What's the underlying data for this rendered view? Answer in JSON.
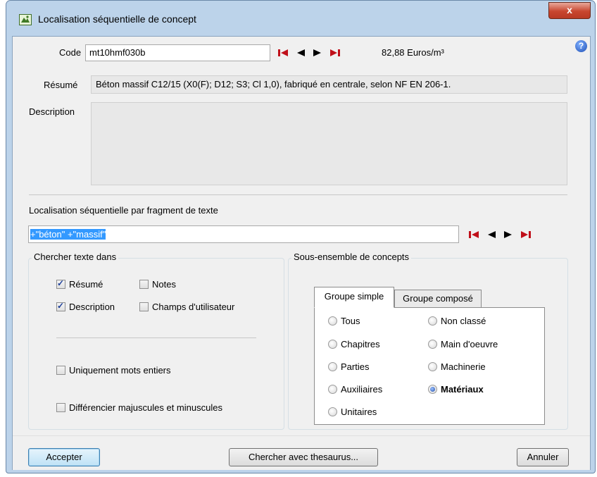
{
  "window": {
    "title": "Localisation séquentielle de concept",
    "close_label": "x"
  },
  "help_label": "?",
  "code": {
    "label": "Code",
    "value": "mt10hmf030b",
    "price": "82,88 Euros/m³"
  },
  "resume": {
    "label": "Résumé",
    "value": "Béton massif C12/15 (X0(F); D12; S3; Cl 1,0), fabriqué en centrale, selon NF EN 206-1."
  },
  "description": {
    "label": "Description",
    "value": ""
  },
  "search": {
    "label": "Localisation séquentielle par fragment de texte",
    "value": "+\"béton\" +\"massif\""
  },
  "search_in": {
    "title": "Chercher texte dans",
    "resume_label": "Résumé",
    "resume_checked": true,
    "notes_label": "Notes",
    "notes_checked": false,
    "description_label": "Description",
    "description_checked": true,
    "user_fields_label": "Champs d'utilisateur",
    "user_fields_checked": false,
    "whole_words_label": "Uniquement mots entiers",
    "case_label": "Différencier majuscules et minuscules"
  },
  "subset": {
    "title": "Sous-ensemble de concepts",
    "tabs": [
      "Groupe simple",
      "Groupe composé"
    ],
    "active_tab": "Groupe simple",
    "left_options": [
      "Tous",
      "Chapitres",
      "Parties",
      "Auxiliaires",
      "Unitaires"
    ],
    "right_options": [
      "Non classé",
      "Main d'oeuvre",
      "Machinerie",
      "Matériaux"
    ],
    "selected": "Matériaux"
  },
  "buttons": {
    "accept": "Accepter",
    "thesaurus": "Chercher avec thesaurus...",
    "cancel": "Annuler"
  },
  "colors": {
    "nav_icon": "#c0101a",
    "nav_arrow": "#000000",
    "selection": "#3399ff"
  }
}
